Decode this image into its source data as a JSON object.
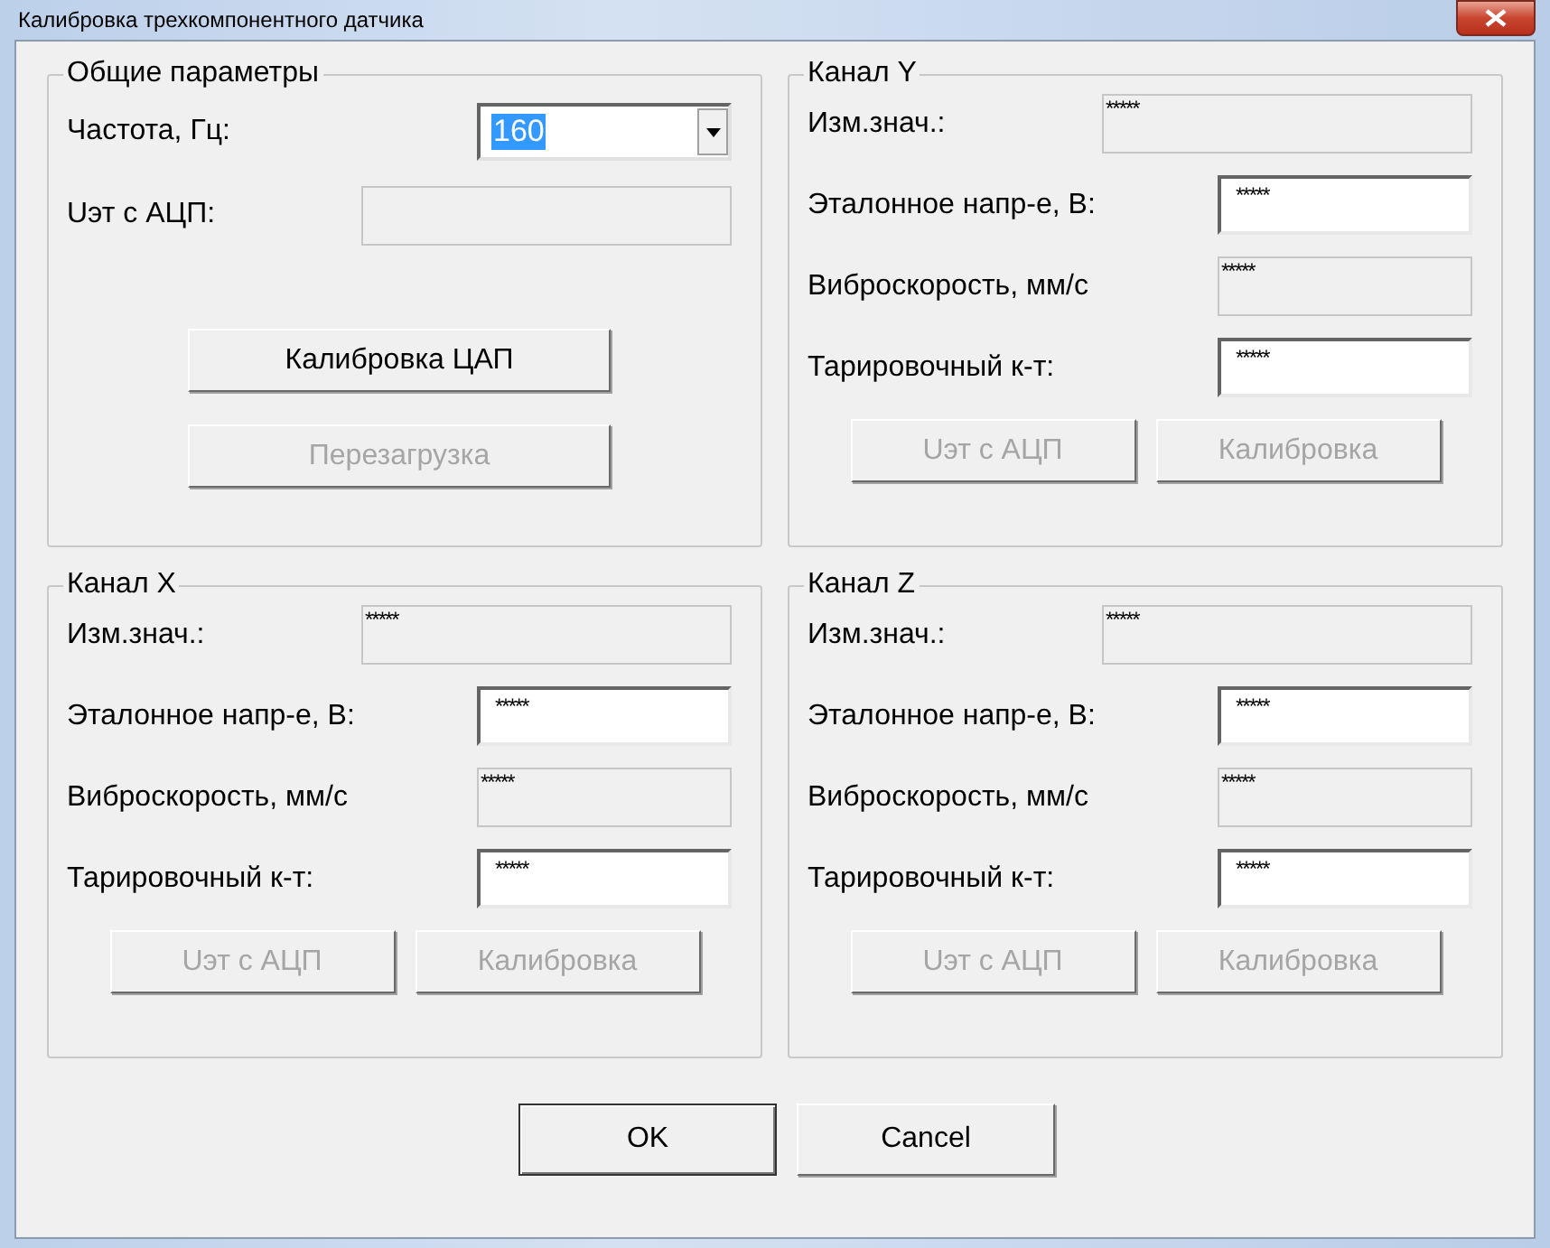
{
  "window": {
    "title": "Калибровка трехкомпонентного датчика"
  },
  "general": {
    "title": "Общие параметры",
    "frequency": {
      "label": "Частота, Гц:",
      "value": "160",
      "selected": true
    },
    "adc": {
      "label": "Uэт с АЦП:"
    },
    "buttons": [
      {
        "label": "Калибровка ЦАП",
        "disabled": false
      },
      {
        "label": "Перезагрузка",
        "disabled": true
      }
    ]
  },
  "channels": [
    {
      "title": "Канал Y",
      "fields": [
        {
          "label": "Изм.знач.:",
          "value": "*****",
          "kind": "readonly"
        },
        {
          "label": "Эталонное напр-е, В:",
          "value": "*****",
          "kind": "input"
        },
        {
          "label": "Виброскорость, мм/с",
          "value": "*****",
          "kind": "readonly"
        },
        {
          "label": "Тарировочный к-т:",
          "value": "*****",
          "kind": "input"
        }
      ],
      "buttons": [
        {
          "label": "Uэт с АЦП",
          "disabled": true
        },
        {
          "label": "Калибровка",
          "disabled": true
        }
      ]
    },
    {
      "title": "Канал X",
      "fields": [
        {
          "label": "Изм.знач.:",
          "value": "*****",
          "kind": "readonly"
        },
        {
          "label": "Эталонное напр-е, В:",
          "value": "*****",
          "kind": "input"
        },
        {
          "label": "Виброскорость, мм/с",
          "value": "*****",
          "kind": "readonly"
        },
        {
          "label": "Тарировочный к-т:",
          "value": "*****",
          "kind": "input"
        }
      ],
      "buttons": [
        {
          "label": "Uэт с АЦП",
          "disabled": true
        },
        {
          "label": "Калибровка",
          "disabled": true
        }
      ]
    },
    {
      "title": "Канал Z",
      "fields": [
        {
          "label": "Изм.знач.:",
          "value": "*****",
          "kind": "readonly"
        },
        {
          "label": "Эталонное напр-е, В:",
          "value": "*****",
          "kind": "input"
        },
        {
          "label": "Виброскорость, мм/с",
          "value": "*****",
          "kind": "readonly"
        },
        {
          "label": "Тарировочный к-т:",
          "value": "*****",
          "kind": "input"
        }
      ],
      "buttons": [
        {
          "label": "Uэт с АЦП",
          "disabled": true
        },
        {
          "label": "Калибровка",
          "disabled": true
        }
      ]
    }
  ],
  "buttons": [
    {
      "label": "OK",
      "default": true
    },
    {
      "label": "Cancel",
      "default": false
    }
  ]
}
